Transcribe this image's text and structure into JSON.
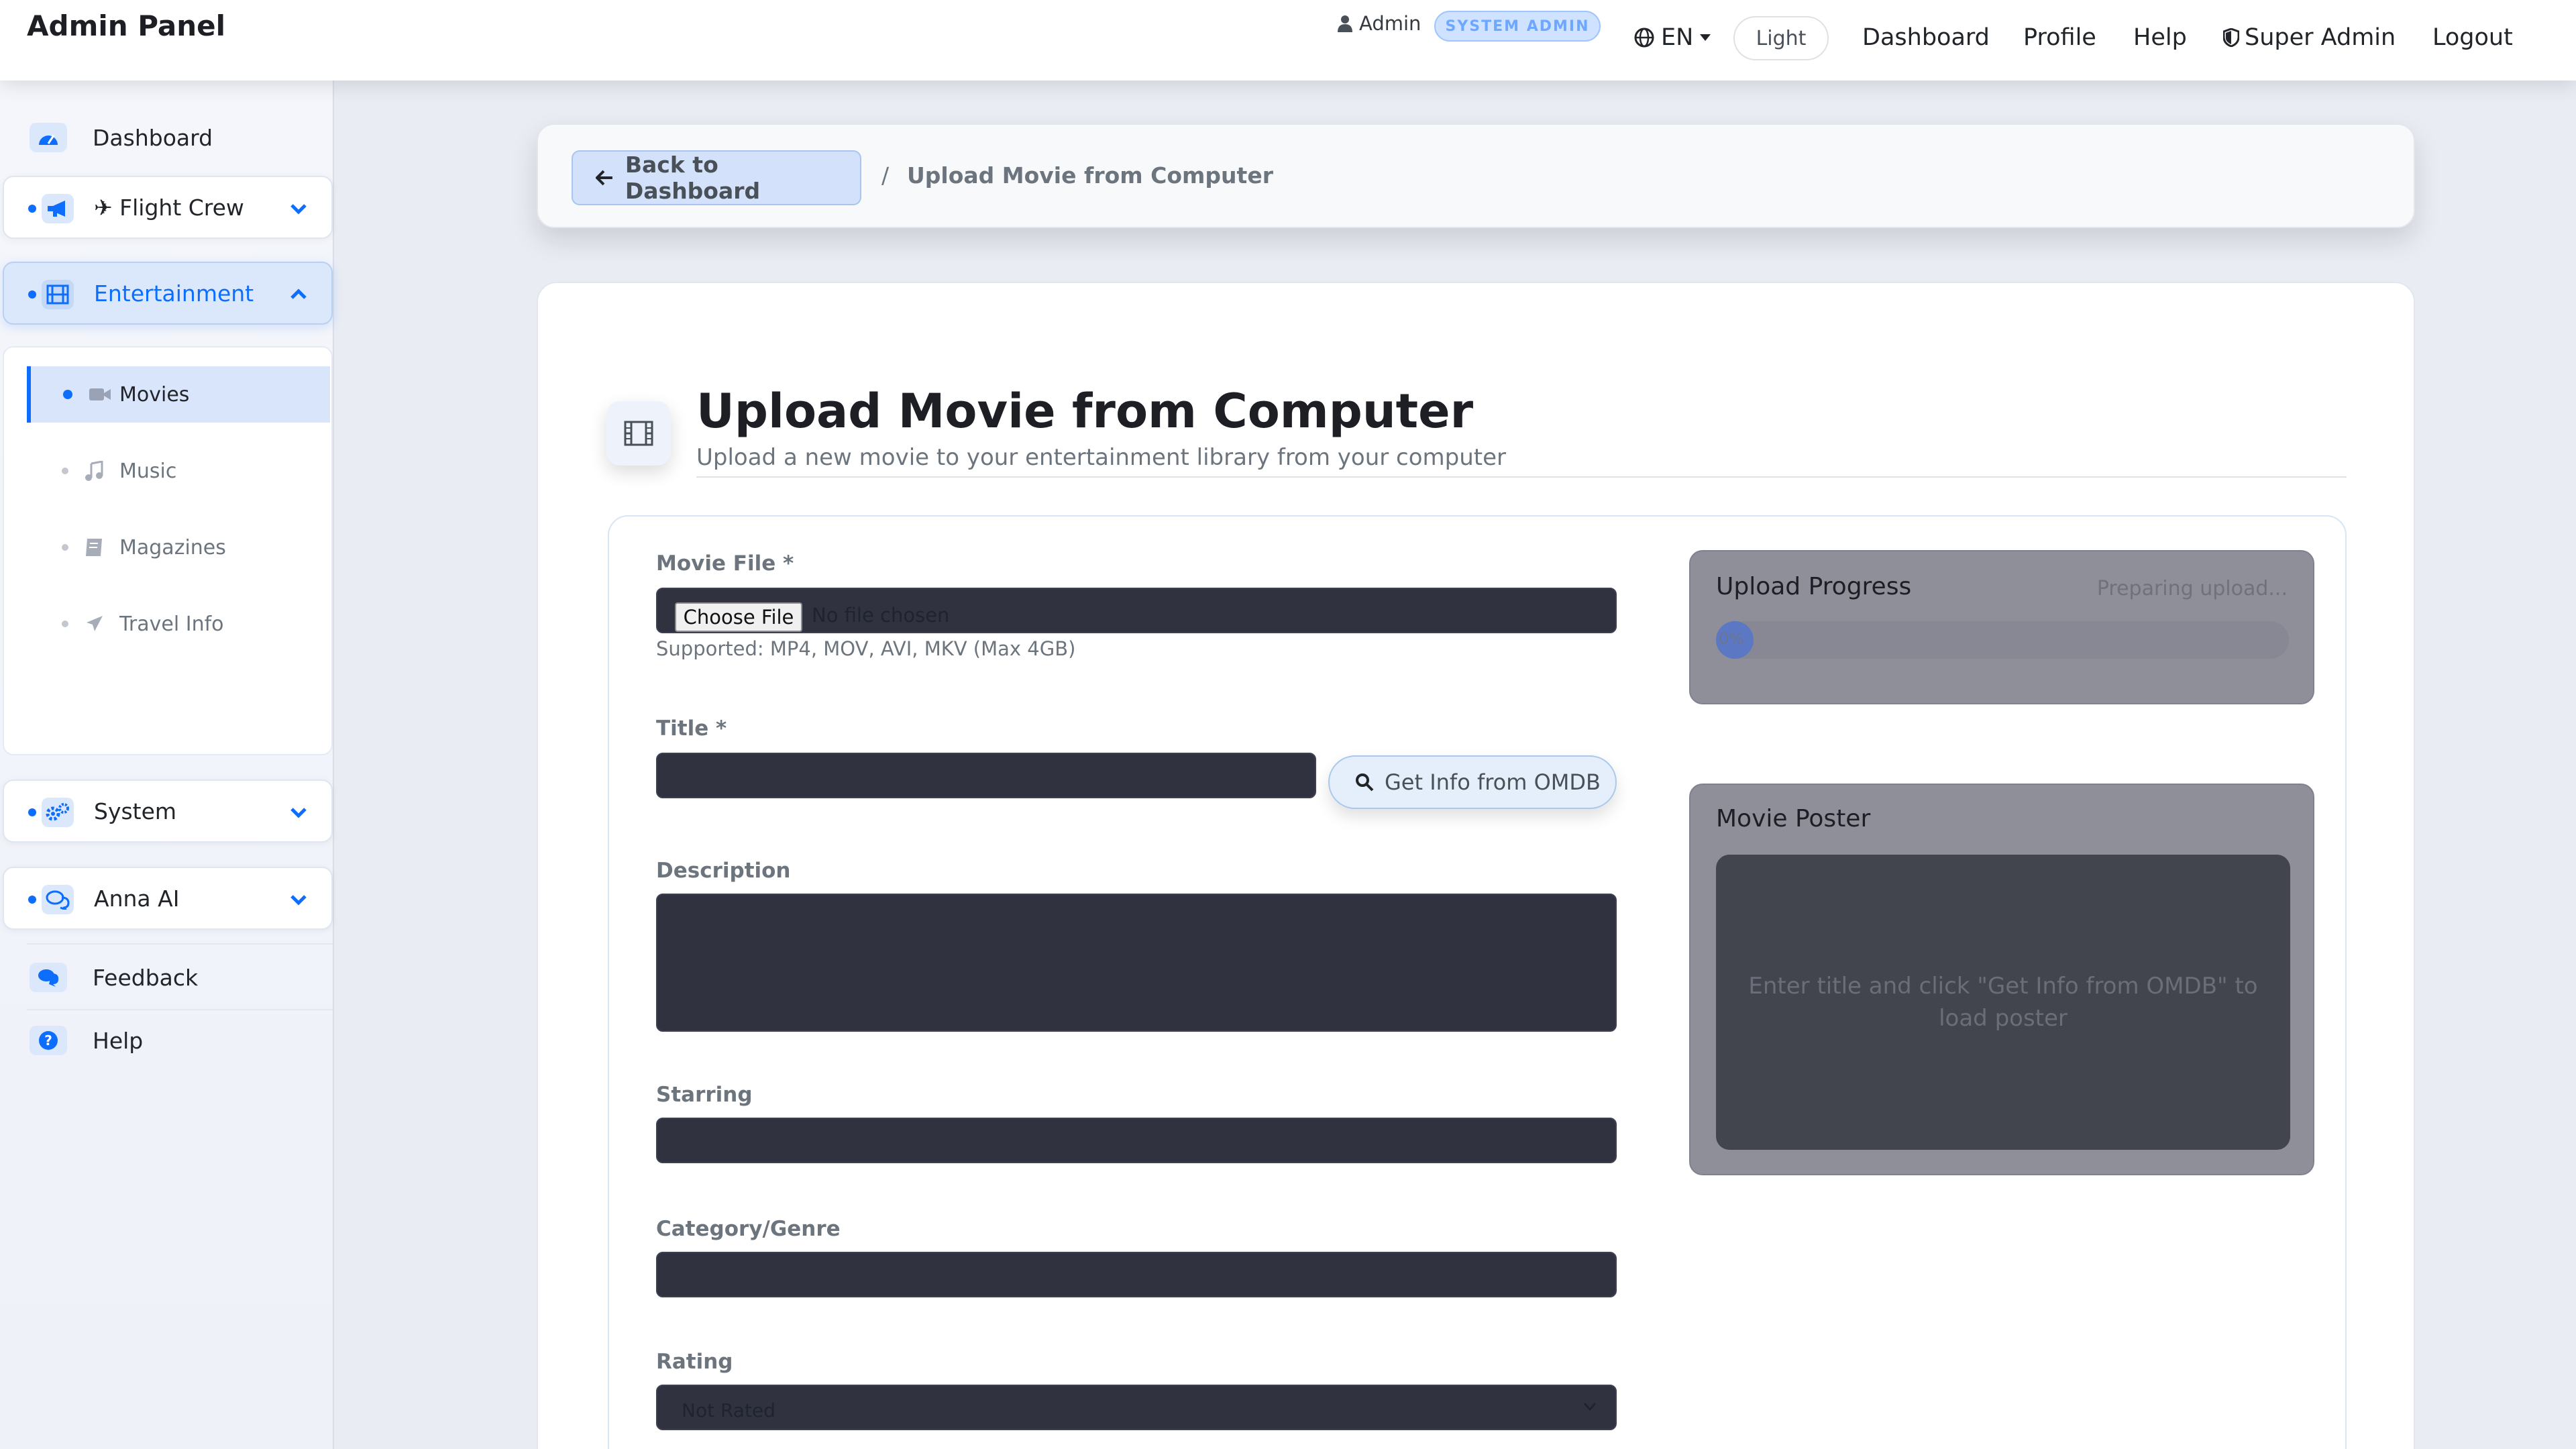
{
  "header": {
    "brand": "Admin Panel",
    "user_name": "Admin",
    "user_badge": "SYSTEM ADMIN",
    "language": "EN",
    "theme_toggle": "Light",
    "nav": {
      "dashboard": "Dashboard",
      "profile": "Profile",
      "help": "Help",
      "super_admin": "Super Admin",
      "logout": "Logout"
    }
  },
  "sidebar": {
    "dashboard": "Dashboard",
    "flight_crew": "✈ Flight Crew",
    "entertainment": " Entertainment",
    "entertainment_items": {
      "movies": "Movies",
      "music": "Music",
      "magazines": "Magazines",
      "travel_info": "Travel Info"
    },
    "system": " System",
    "anna_ai": " Anna AI",
    "feedback": "Feedback",
    "help": "Help"
  },
  "breadcrumb": {
    "back_label": "Back to Dashboard",
    "separator": "/",
    "current": "Upload Movie from Computer"
  },
  "page": {
    "title": "Upload Movie from Computer",
    "subtitle": "Upload a new movie to your entertainment library from your computer"
  },
  "form": {
    "movie_file": {
      "label": "Movie File *",
      "button": "Choose File",
      "status": "No file chosen",
      "help": "Supported: MP4, MOV, AVI, MKV (Max 4GB)"
    },
    "title": {
      "label": "Title *",
      "value": ""
    },
    "omdb_button": "Get Info from OMDB",
    "description": {
      "label": "Description",
      "value": ""
    },
    "starring": {
      "label": "Starring",
      "value": ""
    },
    "genre": {
      "label": "Category/Genre",
      "value": ""
    },
    "rating": {
      "label": "Rating",
      "selected": "Not Rated"
    }
  },
  "upload_progress": {
    "title": "Upload Progress",
    "status": "Preparing upload...",
    "percent": 0,
    "percent_label": "0%"
  },
  "poster": {
    "title": "Movie Poster",
    "placeholder": "Enter title and click \"Get Info from OMDB\" to load poster"
  },
  "colors": {
    "accent": "#0d6efd",
    "input_bg": "#30333f",
    "panel_bg": "#8e8f99"
  }
}
